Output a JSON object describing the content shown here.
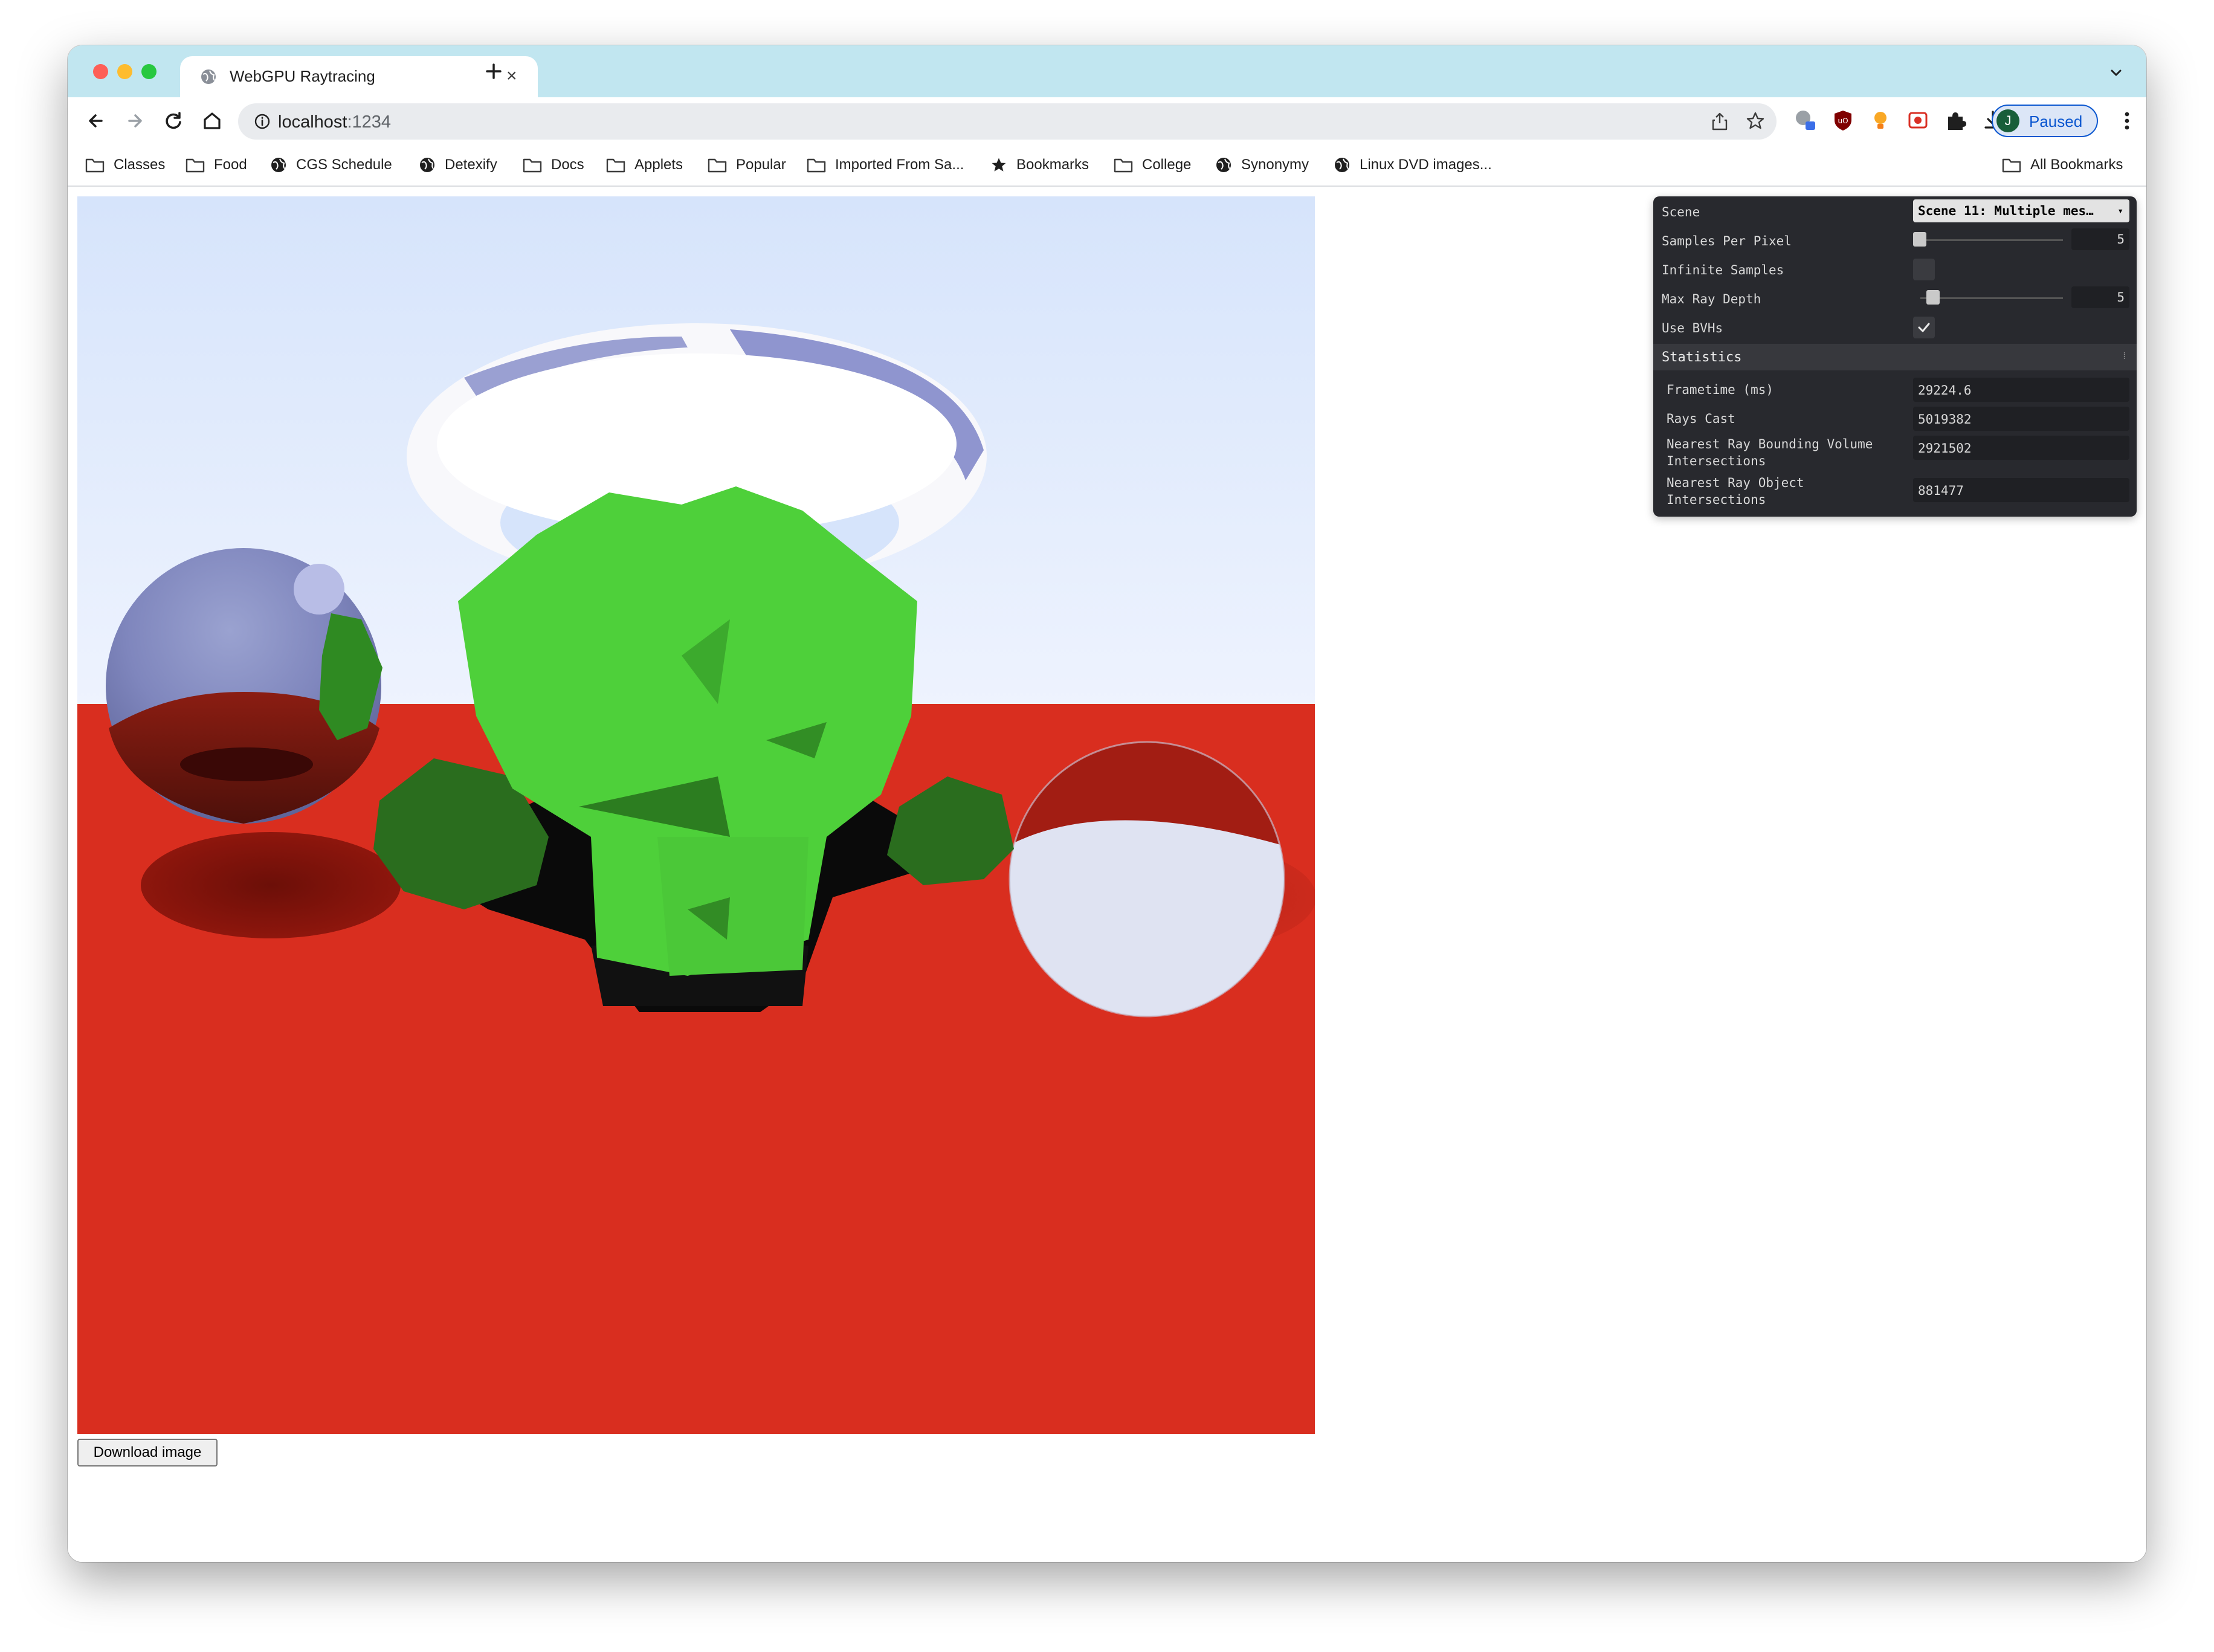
{
  "browser": {
    "tab_title": "WebGPU Raytracing",
    "url_host": "localhost",
    "url_port": ":1234",
    "profile_initial": "J",
    "profile_status": "Paused",
    "accent_color": "#0b57d0",
    "tabstrip_color": "#c1e6f0"
  },
  "bookmarks": {
    "items": [
      {
        "label": "Classes",
        "icon": "folder-icon"
      },
      {
        "label": "Food",
        "icon": "folder-icon"
      },
      {
        "label": "CGS Schedule",
        "icon": "globe-icon"
      },
      {
        "label": "Detexify",
        "icon": "globe-icon"
      },
      {
        "label": "Docs",
        "icon": "folder-icon"
      },
      {
        "label": "Applets",
        "icon": "folder-icon"
      },
      {
        "label": "Popular",
        "icon": "folder-icon"
      },
      {
        "label": "Imported From Sa...",
        "icon": "folder-icon"
      },
      {
        "label": "Bookmarks",
        "icon": "star-icon"
      },
      {
        "label": "College",
        "icon": "folder-icon"
      },
      {
        "label": "Synonymy",
        "icon": "globe-icon"
      },
      {
        "label": "Linux DVD images...",
        "icon": "globe-icon"
      }
    ],
    "all_bookmarks": "All Bookmarks"
  },
  "page": {
    "download_label": "Download image"
  },
  "gui": {
    "scene_label": "Scene",
    "scene_value": "Scene 11: Multiple mes…",
    "samples_label": "Samples Per Pixel",
    "samples_value": "5",
    "infinite_label": "Infinite Samples",
    "infinite_checked": false,
    "depth_label": "Max Ray Depth",
    "depth_value": "5",
    "bvh_label": "Use BVHs",
    "bvh_checked": true,
    "stats_title": "Statistics",
    "stats": [
      {
        "label": "Frametime (ms)",
        "value": "29224.6"
      },
      {
        "label": "Rays Cast",
        "value": "5019382"
      },
      {
        "label": "Nearest Ray Bounding Volume Intersections",
        "value": "2921502"
      },
      {
        "label": "Nearest Ray Object Intersections",
        "value": "881477"
      }
    ]
  }
}
